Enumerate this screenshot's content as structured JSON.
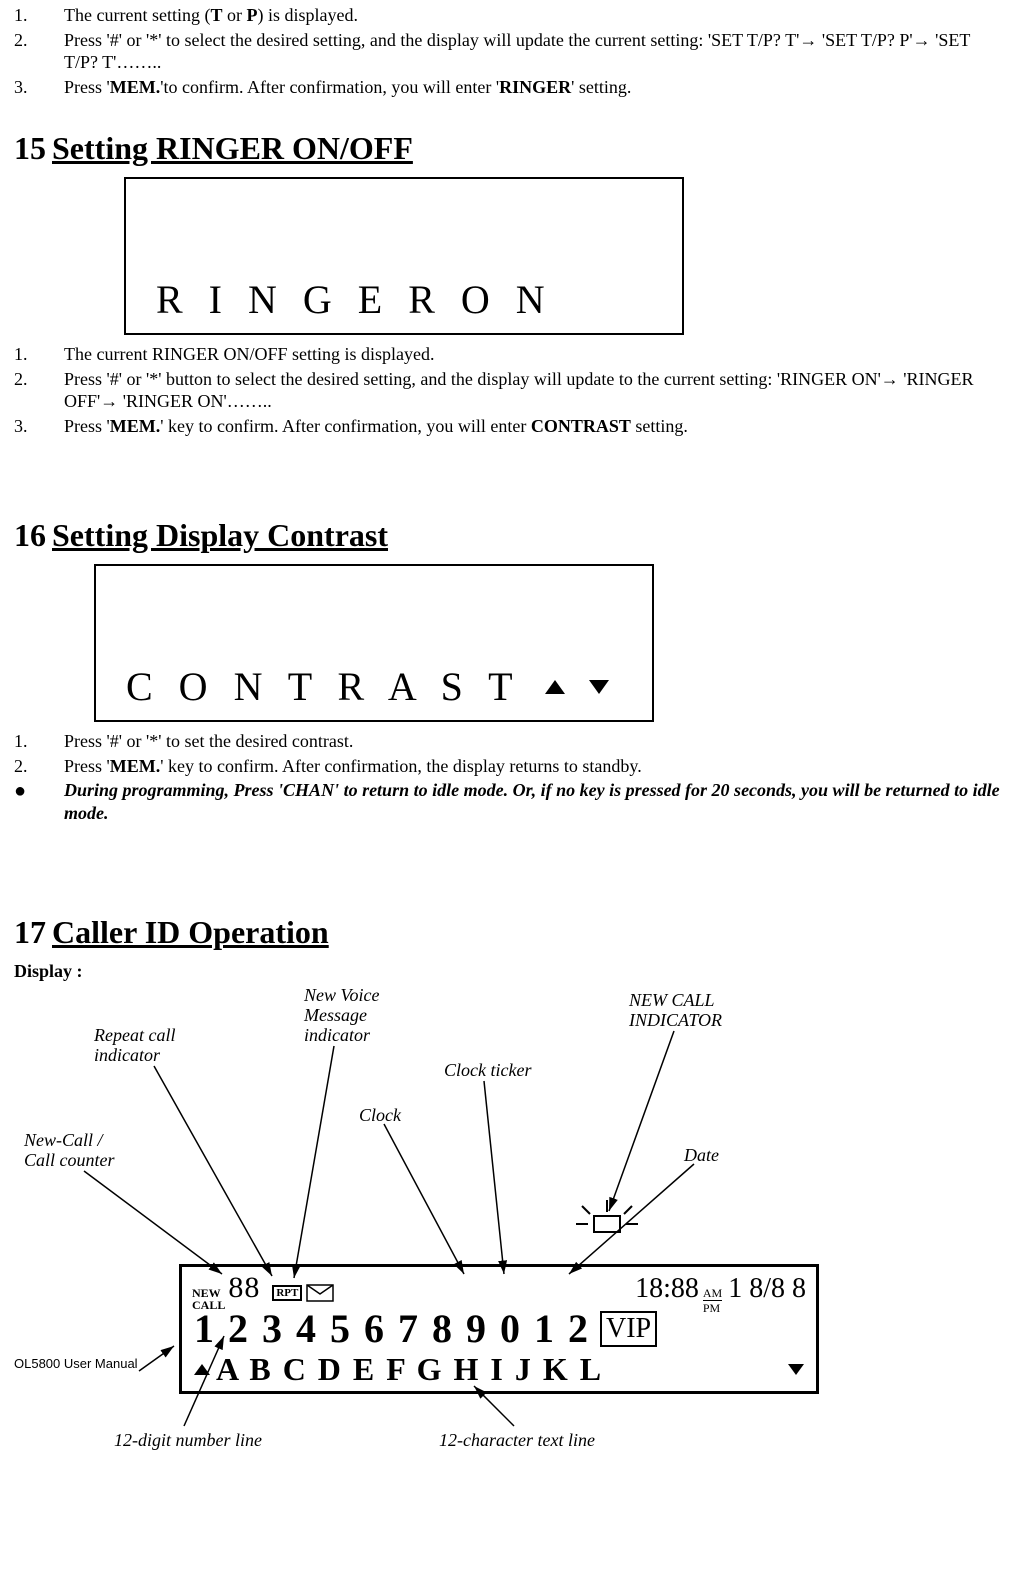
{
  "intro": {
    "items": [
      {
        "n": "1.",
        "text_a": "The current setting (",
        "bold_a": "T",
        "text_b": " or ",
        "bold_b": "P",
        "text_c": ") is displayed."
      },
      {
        "n": "2.",
        "text": "Press '#' or '*' to select the desired setting, and the display will update the current setting: 'SET T/P? T'→ 'SET T/P? P'→ 'SET T/P? T'…….."
      },
      {
        "n": "3.",
        "text_a": "Press '",
        "bold_a": "MEM.",
        "text_b": "'to confirm. After confirmation, you will enter '",
        "bold_b": "RINGER",
        "text_c": "' setting."
      }
    ]
  },
  "s15": {
    "num": "15",
    "title": "Setting RINGER ON/OFF",
    "lcd": "R I N G E R   O N",
    "items": [
      {
        "n": "1.",
        "text": "The current RINGER ON/OFF setting is displayed."
      },
      {
        "n": "2.",
        "text": "Press '#' or '*' button to select the desired setting, and the display will update to the current setting: 'RINGER ON'→ 'RINGER OFF'→  'RINGER ON'…….."
      },
      {
        "n": "3.",
        "text_a": "Press '",
        "bold_a": "MEM.",
        "text_b": "' key to confirm. After confirmation, you will enter ",
        "bold_b": "CONTRAST",
        "text_c": " setting."
      }
    ]
  },
  "s16": {
    "num": "16",
    "title": "Setting Display Contrast",
    "lcd": "C O N T R A S T",
    "items": [
      {
        "n": "1.",
        "text": "Press '#' or '*' to set the desired contrast."
      },
      {
        "n": "2.",
        "text_a": "Press '",
        "bold_a": "MEM.",
        "text_b": "' key to confirm. After confirmation, the display returns to standby."
      }
    ],
    "note": "During programming, Press 'CHAN' to return to idle mode. Or, if no key is pressed for 20 seconds, you will be returned to idle mode."
  },
  "s17": {
    "num": "17",
    "title": "Caller ID Operation",
    "display_label": "Display :",
    "labels": {
      "new_voice": "New Voice\nMessage\nindicator",
      "repeat": "Repeat call\nindicator",
      "newcall_ind": "NEW CALL\nINDICATOR",
      "clock_ticker": "Clock ticker",
      "clock": "Clock",
      "new_counter": "New-Call /\nCall counter",
      "date": "Date",
      "digit_line": "12-digit number line",
      "text_line": "12-character text line"
    },
    "lcd": {
      "newcall": "NEW\nCALL",
      "count": "88",
      "rpt": "RPT",
      "clock": "18:88",
      "am": "AM",
      "pm": "PM",
      "date": "1 8/8 8",
      "digits": "1  2  3  4  5  6  7  8  9  0  1  2",
      "vip": "VIP",
      "letters": "A  B  C D E  F  G  H  I  J  K  L"
    },
    "footer": "OL5800 User Manual"
  }
}
